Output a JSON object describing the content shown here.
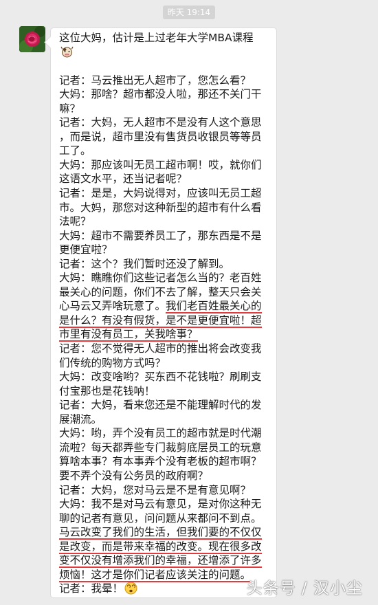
{
  "timestamp": "昨天 19:14",
  "message": {
    "line_1": "这位大妈，估计是上过老年大学MBA课程",
    "line_2_icon": "cow-face-icon",
    "lines": [
      "记者：马云推出无人超市了，您怎么看？",
      "大妈：那啥？超市都没人啦，那还不关门干",
      "嘛？",
      "记者：大妈，无人超市不是没有人这个意思",
      "，而是说，超市里没有售货员收银员等等员",
      "工了。",
      "大妈：那应该叫无员工超市啊！哎，就你们",
      "这语文水平，还当记者呢？",
      "记者：是是，大妈说得对，应该叫无员工超",
      "市。大妈，那您对这种新型的超市有什么看",
      "法呢？",
      "大妈：超市不需要养员工了，那东西是不是",
      "更便宜啦？",
      "记者：这个？我们暂时还没了解到。",
      "大妈：瞧瞧你们这些记者怎么当的？老百姓",
      "最关心的问题，你们不去了解，整天只会关",
      "心马云又弄啥玩意了。我们老百姓最关心的",
      "是什么？有没有假货，是不是更便宜啦！超",
      "市里有没有员工，关我啥事？",
      "记者：您不觉得无人超市的推出将会改变我",
      "们传统的购物方式吗？",
      "大妈：改变啥哟？买东西不花钱啦？刷刷支",
      "付宝那也是花钱呐！",
      "记者：大妈，看来您还是不能理解时代的发",
      "展潮流。",
      "大妈：哟，弄个没有员工的超市就是时代潮",
      "流啦？每天都弄些专门裁剪底层员工的玩意",
      "算啥本事？有本事弄个没有老板的超市啊？",
      "要不弄个没有公务员的政府啊？",
      "记者：大妈，您对马云是不是有意见啊？",
      "大妈：我不是对马云有意见，是对你这种无",
      "聊的记者有意见，问问题从来都问不到点。",
      "马云改变了我们的生活，但我们要的不仅仅",
      "是改变，而是带来幸福的改变。现在很多改",
      "变不仅没有增添我们的幸福，还增添了许多",
      "烦恼！这才是你们记者应该关注的问题。"
    ],
    "last_line": "记者：我晕！",
    "last_icon": "dizzy-face-icon"
  },
  "watermark": "头条号 / 汉小尘",
  "colors": {
    "underline": "#e23b3b",
    "background": "#ebebeb",
    "bubble": "#ffffff"
  }
}
